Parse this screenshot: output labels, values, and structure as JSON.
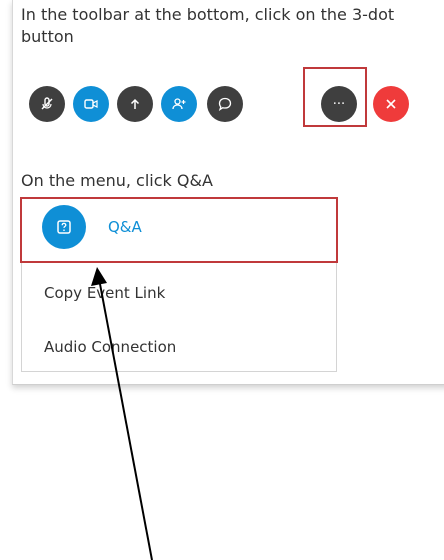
{
  "instructions": {
    "step1": "In the toolbar at the bottom, click on the 3-dot button",
    "step2": "On the menu, click Q&A"
  },
  "toolbar": {
    "buttons": [
      {
        "name": "mute-button",
        "icon": "microphone-muted-icon",
        "color": "#3f3f3f"
      },
      {
        "name": "video-button",
        "icon": "video-camera-icon",
        "color": "#0f8fd6"
      },
      {
        "name": "share-button",
        "icon": "share-up-arrow-icon",
        "color": "#3f3f3f"
      },
      {
        "name": "participants-button",
        "icon": "add-person-icon",
        "color": "#0f8fd6"
      },
      {
        "name": "chat-button",
        "icon": "chat-bubble-icon",
        "color": "#3f3f3f"
      },
      {
        "name": "more-options-button",
        "icon": "ellipsis-icon",
        "glyph": "···",
        "color": "#3f3f3f"
      },
      {
        "name": "leave-button",
        "icon": "close-x-icon",
        "color": "#ef3b3b"
      }
    ]
  },
  "menu": {
    "items": [
      {
        "label": "Q&A",
        "icon": "question-box-icon"
      },
      {
        "label": "Copy Event Link"
      },
      {
        "label": "Audio Connection"
      }
    ]
  },
  "colors": {
    "accent_blue": "#0f8fd6",
    "highlight_red": "#c0393b",
    "dark_button": "#3f3f3f",
    "leave_red": "#ef3b3b"
  }
}
